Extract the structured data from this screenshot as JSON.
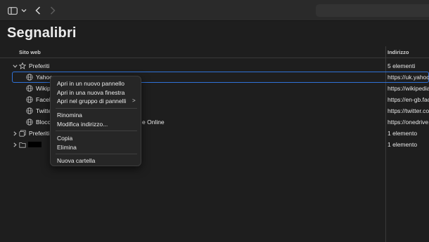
{
  "toolbar": {
    "sidebar_icon": "sidebar-icon",
    "caret_icon": "chevron-down-icon",
    "back_icon": "back-chevron-icon",
    "forward_icon": "forward-chevron-icon"
  },
  "page": {
    "title": "Segnalibri"
  },
  "columns": {
    "site": "Sito web",
    "address": "Indirizzo"
  },
  "rows": [
    {
      "name": "Preferiti",
      "address": "5 elementi",
      "icon": "star-icon",
      "disclosure": "expanded"
    },
    {
      "name": "Yahoo",
      "address": "https://uk.yahoo.",
      "icon": "globe-icon"
    },
    {
      "name": "Wikip",
      "address": "https://wikipedia",
      "icon": "globe-icon"
    },
    {
      "name": "Faceb",
      "address": "https://en-gb.fac",
      "icon": "globe-icon"
    },
    {
      "name": "Twitte",
      "address": "https://twitter.co",
      "icon": "globe-icon"
    },
    {
      "name": "Blocc",
      "name_tail": "e Online",
      "address": "https://onedrive.l",
      "icon": "globe-icon"
    },
    {
      "name": "Preferiti",
      "address": "1 elemento",
      "icon": "tab-group-icon",
      "disclosure": "collapsed"
    },
    {
      "name": "",
      "address": "1 elemento",
      "icon": "folder-icon",
      "disclosure": "collapsed",
      "redacted": true
    }
  ],
  "context_menu": {
    "items": [
      "Apri in un nuovo pannello",
      "Apri in una nuova finestra",
      "Apri nel gruppo di pannelli",
      "Rinomina",
      "Modifica indirizzo...",
      "Copia",
      "Elimina",
      "Nuova cartella"
    ],
    "submenu_arrow": ">"
  },
  "colors": {
    "accent": "#2f72d8",
    "background": "#1e1e1e",
    "menu": "#262626"
  }
}
